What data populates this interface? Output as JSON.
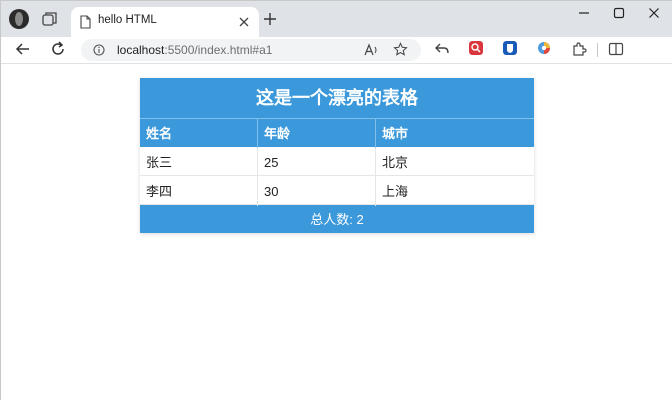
{
  "browser": {
    "tab": {
      "title": "hello HTML"
    },
    "address": {
      "host": "localhost",
      "path": ":5500/index.html#a1"
    }
  },
  "icons": {
    "profile": "profile-avatar-icon",
    "workspaces": "workspaces-icon",
    "page": "page-icon",
    "close": "close-icon",
    "new_tab": "plus-icon",
    "minimize": "minimize-icon",
    "maximize": "maximize-icon",
    "window_close": "window-close-icon",
    "back": "back-arrow-icon",
    "refresh": "refresh-icon",
    "info": "info-icon",
    "read_aloud": "read-aloud-icon",
    "favorite": "star-icon",
    "share_back": "reply-icon",
    "ext_red": "red-extension-icon",
    "ext_blue": "blue-extension-icon",
    "ext_color": "color-extension-icon",
    "extensions": "puzzle-icon",
    "split": "split-screen-icon"
  },
  "colors": {
    "accent": "#3a98db",
    "ext_red": "#d9363e",
    "ext_blue": "#1a5bb8"
  },
  "table": {
    "caption": "这是一个漂亮的表格",
    "headers": [
      "姓名",
      "年龄",
      "城市"
    ],
    "rows": [
      [
        "张三",
        "25",
        "北京"
      ],
      [
        "李四",
        "30",
        "上海"
      ]
    ],
    "footer": "总人数: 2"
  }
}
